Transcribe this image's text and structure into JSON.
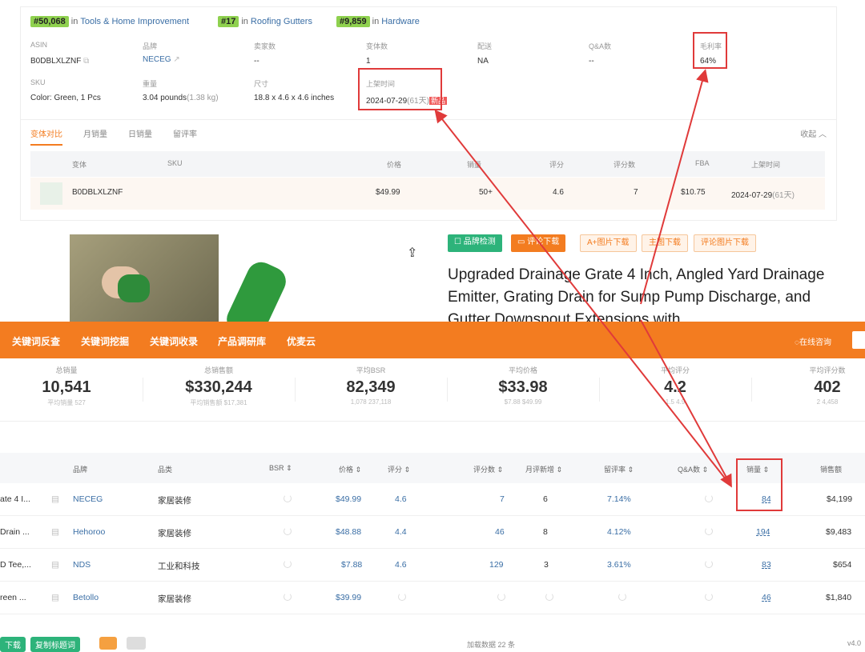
{
  "ranks": [
    {
      "num": "#50,068",
      "in": "in",
      "category": "Tools & Home Improvement"
    },
    {
      "num": "#17",
      "in": "in",
      "category": "Roofing Gutters"
    },
    {
      "num": "#9,859",
      "in": "in",
      "category": "Hardware"
    }
  ],
  "info": {
    "asin_label": "ASIN",
    "asin": "B0DBLXLZNF",
    "brand_label": "品牌",
    "brand": "NECEG",
    "sellers_label": "卖家数",
    "sellers": "--",
    "variants_label": "变体数",
    "variants": "1",
    "delivery_label": "配送",
    "delivery": "NA",
    "qa_label": "Q&A数",
    "qa": "--",
    "margin_label": "毛利率",
    "margin": "64%",
    "sku_label": "SKU",
    "sku": "Color: Green, 1 Pcs",
    "weight_label": "重量",
    "weight": "3.04 pounds",
    "weight_kg": "(1.38 kg)",
    "size_label": "尺寸",
    "size": "18.8 x 4.6 x 4.6 inches",
    "listed_label": "上架时间",
    "listed": "2024-07-29",
    "listed_days": "(61天)",
    "new_tag": "新品"
  },
  "tabs": [
    "变体对比",
    "月销量",
    "日销量",
    "留评率"
  ],
  "collapse": "收起",
  "variant_table": {
    "headers": [
      "变体",
      "SKU",
      "价格",
      "销量",
      "评分",
      "评分数",
      "FBA",
      "上架时间"
    ],
    "row": {
      "asin": "B0DBLXLZNF",
      "price": "$49.99",
      "sales": "50+",
      "rating": "4.6",
      "rating_count": "7",
      "fba": "$10.75",
      "listed": "2024-07-29",
      "listed_days": "(61天)"
    }
  },
  "buttons": [
    "品牌检测",
    "评论下载",
    "A+图片下载",
    "主图下载",
    "评论图片下载"
  ],
  "product_title": "Upgraded Drainage Grate 4 Inch, Angled Yard Drainage Emitter, Grating Drain for Sump Pump Discharge, and Gutter Downspout Extensions with",
  "nav": [
    "关键词反查",
    "关键词挖掘",
    "关键词收录",
    "产品调研库",
    "优麦云"
  ],
  "consult": "在线咨询",
  "stats": [
    {
      "title": "总销量",
      "value": "10,541",
      "sub": "平均销量 527"
    },
    {
      "title": "总销售额",
      "value": "$330,244",
      "sub": "平均销售额 $17,381"
    },
    {
      "title": "平均BSR",
      "value": "82,349",
      "sub": "1,078  237,118"
    },
    {
      "title": "平均价格",
      "value": "$33.98",
      "sub": "$7.88  $49.99"
    },
    {
      "title": "平均评分",
      "value": "4.2",
      "sub": "1.5  4.9"
    },
    {
      "title": "平均评分数",
      "value": "402",
      "sub": "2  4,458"
    }
  ],
  "list_headers": [
    "品牌",
    "品类",
    "BSR",
    "价格",
    "评分",
    "评分数",
    "月评新增",
    "留评率",
    "Q&A数",
    "销量",
    "销售额"
  ],
  "rows": [
    {
      "name": "ate 4 I...",
      "brand": "NECEG",
      "cat": "家居装修",
      "price": "$49.99",
      "rating": "4.6",
      "rcount": "7",
      "newr": "6",
      "rate": "7.14%",
      "sales": "84",
      "revenue": "$4,199"
    },
    {
      "name": "Drain ...",
      "brand": "Hehoroo",
      "cat": "家居装修",
      "price": "$48.88",
      "rating": "4.4",
      "rcount": "46",
      "newr": "8",
      "rate": "4.12%",
      "sales": "194",
      "revenue": "$9,483"
    },
    {
      "name": "D Tee,...",
      "brand": "NDS",
      "cat": "工业和科技",
      "price": "$7.88",
      "rating": "4.6",
      "rcount": "129",
      "newr": "3",
      "rate": "3.61%",
      "sales": "83",
      "revenue": "$654"
    },
    {
      "name": "reen ...",
      "brand": "Betollo",
      "cat": "家居装修",
      "price": "$39.99",
      "rating": "",
      "rcount": "",
      "newr": "",
      "rate": "",
      "sales": "46",
      "revenue": "$1,840"
    }
  ],
  "footer": {
    "download": "下载",
    "keywords": "复制标题词",
    "loaded": "加载数据 22 条",
    "version": "v4.0"
  }
}
